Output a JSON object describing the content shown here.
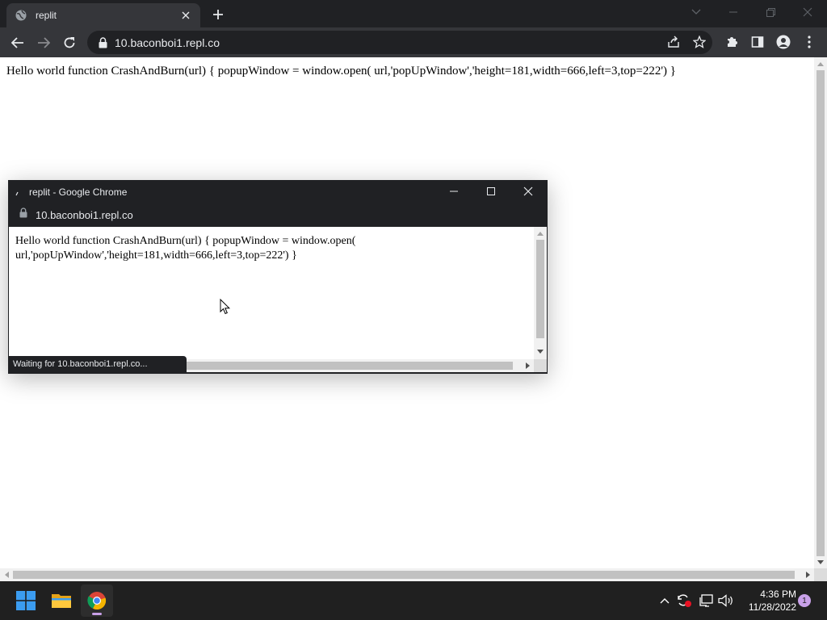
{
  "main_window": {
    "tab_title": "replit",
    "url": "10.baconboi1.repl.co",
    "page_text": "Hello world function CrashAndBurn(url) { popupWindow = window.open( url,'popUpWindow','height=181,width=666,left=3,top=222') }"
  },
  "popup_window": {
    "title": "replit - Google Chrome",
    "url": "10.baconboi1.repl.co",
    "content_line1": "Hello world function CrashAndBurn(url) { popupWindow = window.open(",
    "content_line2": "url,'popUpWindow','height=181,width=666,left=3,top=222') }",
    "status_text": "Waiting for 10.baconboi1.repl.co..."
  },
  "taskbar": {
    "apps": [
      "windows-start",
      "file-explorer",
      "google-chrome"
    ],
    "active_app": "google-chrome",
    "time": "4:36 PM",
    "date": "11/28/2022",
    "notification_count": "1"
  },
  "colors": {
    "titlebar": "#202124",
    "toolbar": "#35363a",
    "taskbar": "#202020",
    "windows_blue": "#3b9cf0",
    "accent": "#c8a0e8"
  }
}
